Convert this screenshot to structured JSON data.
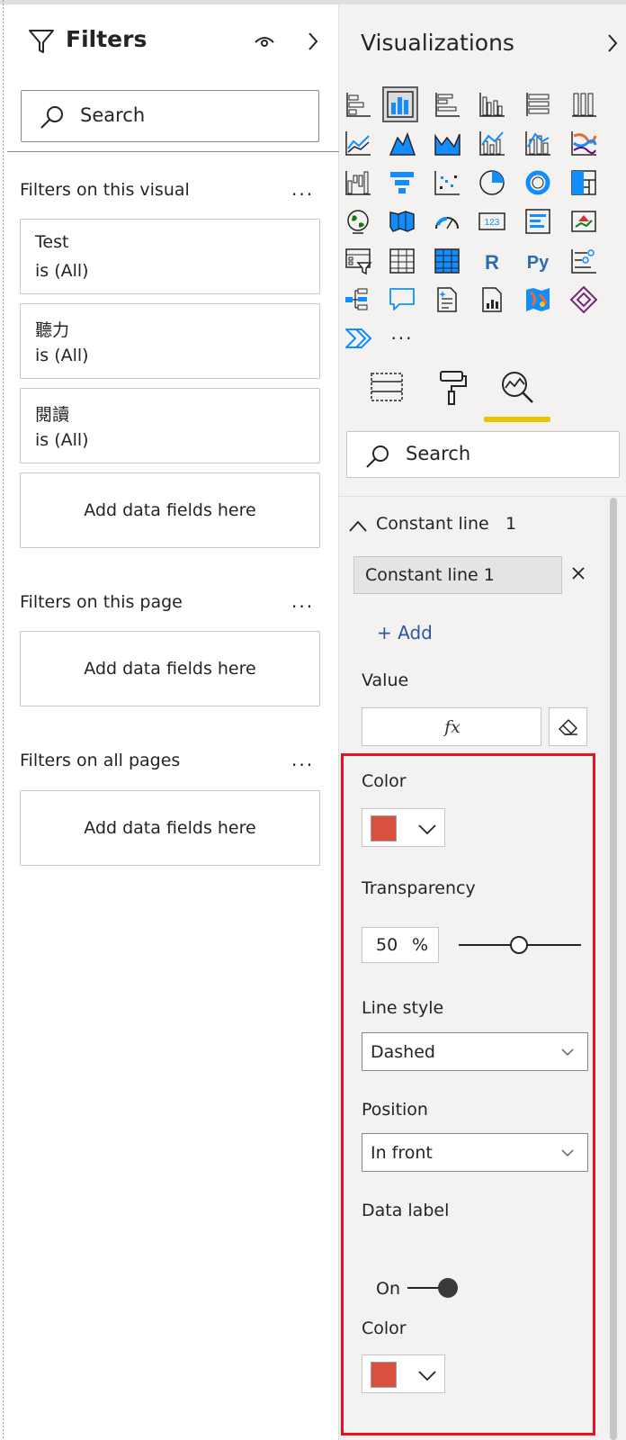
{
  "filters": {
    "title": "Filters",
    "search_placeholder": "Search",
    "sections": {
      "visual": {
        "title": "Filters on this visual",
        "more": "..."
      },
      "page": {
        "title": "Filters on this page",
        "more": "..."
      },
      "all": {
        "title": "Filters on all pages",
        "more": "..."
      }
    },
    "cards": [
      {
        "name": "Test",
        "value": "is (All)"
      },
      {
        "name": "聽力",
        "value": "is (All)"
      },
      {
        "name": "閱讀",
        "value": "is (All)"
      }
    ],
    "add_fields": "Add data fields here"
  },
  "viz": {
    "title": "Visualizations",
    "more_visuals": "···",
    "search_placeholder": "Search",
    "icons": [
      "stacked-bar-chart-icon",
      "stacked-column-chart-icon",
      "clustered-bar-chart-icon",
      "clustered-column-chart-icon",
      "100-stacked-bar-chart-icon",
      "100-stacked-column-chart-icon",
      "line-chart-icon",
      "area-chart-icon",
      "stacked-area-chart-icon",
      "line-clustered-column-icon",
      "line-stacked-column-icon",
      "ribbon-chart-icon",
      "waterfall-chart-icon",
      "funnel-icon",
      "scatter-chart-icon",
      "pie-chart-icon",
      "donut-chart-icon",
      "treemap-icon",
      "map-icon",
      "filled-map-icon",
      "gauge-icon",
      "card-icon",
      "multi-row-card-icon",
      "kpi-icon",
      "slicer-icon",
      "table-icon",
      "matrix-icon",
      "r-visual-icon",
      "python-visual-icon",
      "key-influencers-icon",
      "decomposition-tree-icon",
      "qa-icon",
      "smart-narrative-icon",
      "paginated-report-icon",
      "azure-map-icon",
      "power-apps-icon",
      "power-automate-icon"
    ],
    "icon_labels": {
      "card": "123",
      "r": "R",
      "python": "Py"
    },
    "constant_line": {
      "section_label": "Constant line",
      "count": "1",
      "item_name": "Constant line 1",
      "add_label": "+ Add",
      "value_label": "Value",
      "fx_label": "fx",
      "color_label": "Color",
      "color": "#d9503f",
      "transparency_label": "Transparency",
      "transparency_value": "50",
      "transparency_unit": "%",
      "line_style_label": "Line style",
      "line_style_value": "Dashed",
      "position_label": "Position",
      "position_value": "In front",
      "data_label_label": "Data label",
      "data_label_state": "On",
      "label_color_label": "Color",
      "label_color": "#d9503f"
    }
  }
}
